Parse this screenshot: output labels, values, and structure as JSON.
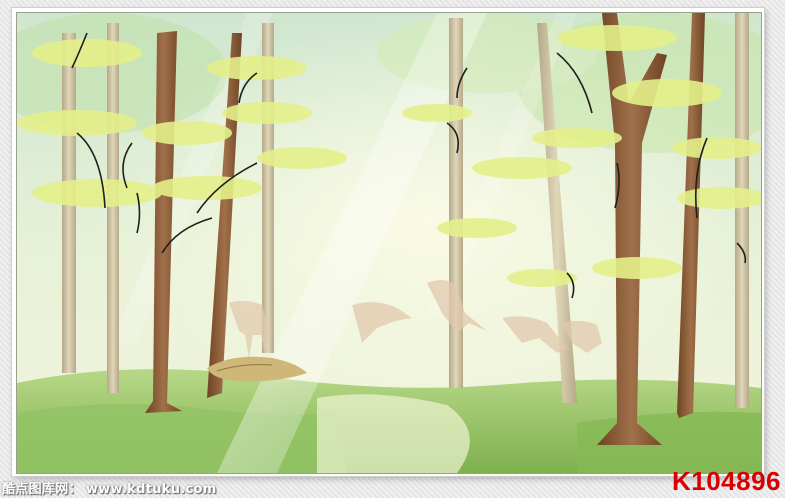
{
  "watermark": {
    "site_name": "酷点图库网：",
    "url": "www.kdtuku.com"
  },
  "product_code": "K104896",
  "colors": {
    "code_red": "#d80000",
    "sky_mint": "#d9ecd2",
    "grass_green": "#8fbf5a",
    "trunk_brown": "#8a5a35",
    "leaf_yellow": "#e4f08a"
  }
}
